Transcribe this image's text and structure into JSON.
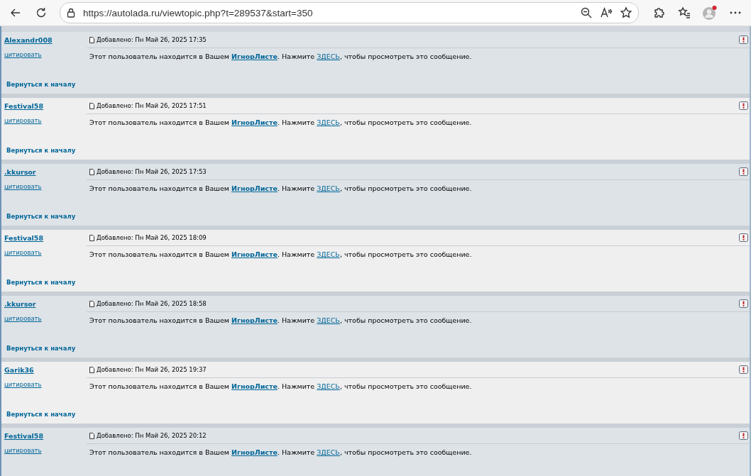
{
  "browser": {
    "url": "https://autolada.ru/viewtopic.php?t=289537&start=350"
  },
  "posts": [
    {
      "author": "Alexandr008",
      "quote": "цитировать",
      "date": "Добавлено: Пн Май 26, 2025 17:35",
      "message": {
        "before": "Этот пользователь находится в Вашем ",
        "ignore_link": "ИгнорЛисте",
        "middle": ". Нажмите ",
        "here_link": "ЗДЕСЬ",
        "after": ", чтобы просмотреть это сообщение."
      },
      "back_to_top": "Вернуться к началу"
    },
    {
      "author": "Festival58",
      "quote": "цитировать",
      "date": "Добавлено: Пн Май 26, 2025 17:51",
      "message": {
        "before": "Этот пользователь находится в Вашем ",
        "ignore_link": "ИгнорЛисте",
        "middle": ". Нажмите ",
        "here_link": "ЗДЕСЬ",
        "after": ", чтобы просмотреть это сообщение."
      },
      "back_to_top": "Вернуться к началу"
    },
    {
      "author": ".kkursor",
      "quote": "цитировать",
      "date": "Добавлено: Пн Май 26, 2025 17:53",
      "message": {
        "before": "Этот пользователь находится в Вашем ",
        "ignore_link": "ИгнорЛисте",
        "middle": ". Нажмите ",
        "here_link": "ЗДЕСЬ",
        "after": ", чтобы просмотреть это сообщение."
      },
      "back_to_top": "Вернуться к началу"
    },
    {
      "author": "Festival58",
      "quote": "цитировать",
      "date": "Добавлено: Пн Май 26, 2025 18:09",
      "message": {
        "before": "Этот пользователь находится в Вашем ",
        "ignore_link": "ИгнорЛисте",
        "middle": ". Нажмите ",
        "here_link": "ЗДЕСЬ",
        "after": ", чтобы просмотреть это сообщение."
      },
      "back_to_top": "Вернуться к началу"
    },
    {
      "author": ".kkursor",
      "quote": "цитировать",
      "date": "Добавлено: Пн Май 26, 2025 18:58",
      "message": {
        "before": "Этот пользователь находится в Вашем ",
        "ignore_link": "ИгнорЛисте",
        "middle": ". Нажмите ",
        "here_link": "ЗДЕСЬ",
        "after": ", чтобы просмотреть это сообщение."
      },
      "back_to_top": "Вернуться к началу"
    },
    {
      "author": "Garik36",
      "quote": "цитировать",
      "date": "Добавлено: Пн Май 26, 2025 19:37",
      "message": {
        "before": "Этот пользователь находится в Вашем ",
        "ignore_link": "ИгнорЛисте",
        "middle": ". Нажмите ",
        "here_link": "ЗДЕСЬ",
        "after": ", чтобы просмотреть это сообщение."
      },
      "back_to_top": "Вернуться к началу"
    },
    {
      "author": "Festival58",
      "quote": "цитировать",
      "date": "Добавлено: Пн Май 26, 2025 20:12",
      "message": {
        "before": "Этот пользователь находится в Вашем ",
        "ignore_link": "ИгнорЛисте",
        "middle": ". Нажмите ",
        "here_link": "ЗДЕСЬ",
        "after": ", чтобы просмотреть это сообщение."
      }
    }
  ]
}
